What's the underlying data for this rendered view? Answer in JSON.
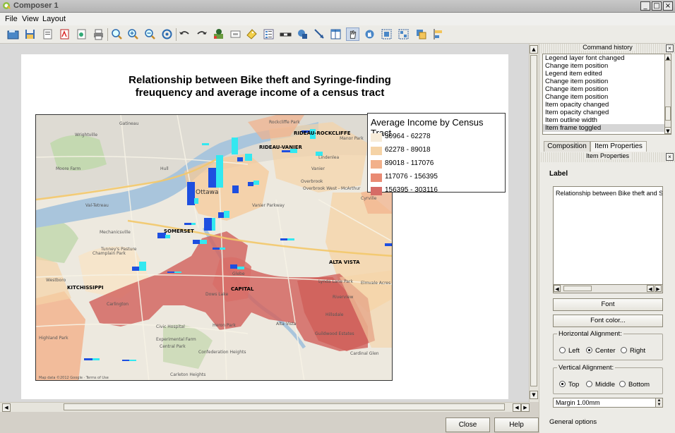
{
  "window": {
    "title": "Composer 1",
    "min": "_",
    "max": "□",
    "close": "×"
  },
  "menu": [
    "File",
    "View",
    "Layout"
  ],
  "toolbar_icons": [
    "add-map-icon",
    "save-icon",
    "template-icon",
    "pdf-icon",
    "svg-icon",
    "print-icon",
    "zoom-full-icon",
    "zoom-in-icon",
    "zoom-out-icon",
    "refresh-icon",
    "undo-icon",
    "redo-icon",
    "add-map-item-icon",
    "add-image-icon",
    "add-label-icon",
    "add-legend-icon",
    "add-scalebar-icon",
    "add-shape-icon",
    "add-arrow-icon",
    "add-table-icon",
    "select-move-icon",
    "move-content-icon",
    "group-icon",
    "ungroup-icon",
    "raise-icon",
    "align-icon"
  ],
  "map": {
    "title_line1": "Relationship between Bike theft and Syringe-finding",
    "title_line2": "freuquency and average income of a census tract",
    "labels": [
      "RIDEAU-ROCKCLIFFE",
      "RIDEAU-VANIER",
      "SOMERSET",
      "ALTA VISTA",
      "KITCHISSIPPI",
      "CAPITAL",
      "Ottawa",
      "Hull",
      "Gatineau",
      "Vanier",
      "Overbrook",
      "Westboro",
      "Glebe",
      "Carleton Heights",
      "Civic Hospital",
      "Experimental Farm",
      "Central Park",
      "Confederation Heights",
      "Heron Park",
      "Alta Vista",
      "Riverview",
      "Elmvale Acres",
      "Lynda Lane Park",
      "Guildwood Estates",
      "Hillsdale",
      "Wrightville",
      "Moore Farm",
      "Val-Tetreau",
      "Champlain Park",
      "Highland Park",
      "Carlington",
      "Mechanicsville",
      "Tunney's Pasture",
      "Dows Lake",
      "Vanier Parkway",
      "Cardinal Glen",
      "Manor Park",
      "Rockcliffe Park",
      "Lindenlea",
      "Cyrville",
      "Overbrook West - McArthur"
    ],
    "attribution": "Map data ©2012 Google · Terms of Use",
    "legend": {
      "title": "Average Income by Census Tract",
      "items": [
        {
          "label": "30964 - 62278",
          "color": "#f7ecd9"
        },
        {
          "label": "62278 - 89018",
          "color": "#f5d3a6"
        },
        {
          "label": "89018 - 117076",
          "color": "#f2b08a"
        },
        {
          "label": "117076 - 156395",
          "color": "#e98a73"
        },
        {
          "label": "156395 - 303116",
          "color": "#d66b66"
        }
      ]
    }
  },
  "dock": {
    "history_title": "Command history",
    "history": [
      "Legend layer font changed",
      "Change item position",
      "Legend item edited",
      "Change item position",
      "Change item position",
      "Change item position",
      "Item opacity changed",
      "Item opacity changed",
      "Item outline width",
      "Item frame toggled"
    ],
    "tabs": [
      "Composition",
      "Item Properties"
    ],
    "props_title": "Item Properties",
    "label_header": "Label",
    "label_text": "Relationship between Bike theft and Syringe-finding",
    "font_button": "Font",
    "font_color_button": "Font color...",
    "halign": {
      "title": "Horizontal Alignment:",
      "options": [
        "Left",
        "Center",
        "Right"
      ],
      "selected": "Center"
    },
    "valign": {
      "title": "Vertical Alignment:",
      "options": [
        "Top",
        "Middle",
        "Bottom"
      ],
      "selected": "Top"
    },
    "margin": "Margin 1.00mm",
    "general_options": "General options"
  },
  "footer": {
    "close": "Close",
    "help": "Help"
  }
}
